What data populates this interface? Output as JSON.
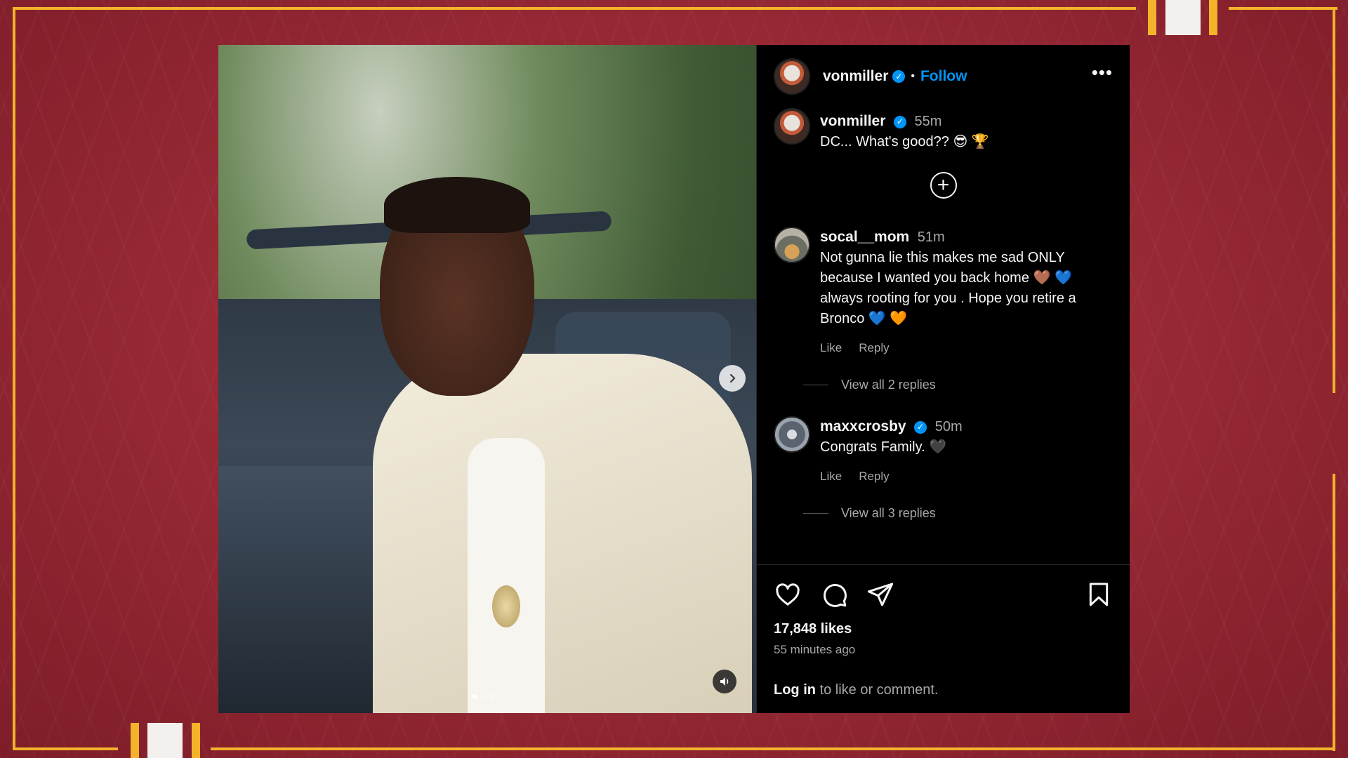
{
  "post": {
    "username": "vonmiller",
    "follow_label": "Follow",
    "separator": "•",
    "more_label": "•••",
    "caption": {
      "username": "vonmiller",
      "time": "55m",
      "text": "DC... What's good?? 😎 🏆"
    },
    "add_label": "+",
    "comments": [
      {
        "username": "socal__mom",
        "time": "51m",
        "text": "Not gunna lie this makes me sad ONLY because I wanted you back home 🤎 💙 always rooting for you . Hope you retire a Bronco 💙 🧡",
        "like_label": "Like",
        "reply_label": "Reply",
        "view_replies": "View all 2 replies"
      },
      {
        "username": "maxxcrosby",
        "time": "50m",
        "text": "Congrats Family. 🖤",
        "like_label": "Like",
        "reply_label": "Reply",
        "view_replies": "View all 3 replies"
      }
    ],
    "likes": "17,848 likes",
    "posted_ago": "55 minutes ago",
    "login_link": "Log in",
    "login_rest": " to like or comment."
  },
  "icons": {
    "verified": "verified-badge-icon",
    "next": "chevron-right-icon",
    "audio": "speaker-icon",
    "like": "heart-icon",
    "comment": "comment-bubble-icon",
    "share": "paper-plane-icon",
    "save": "bookmark-icon"
  },
  "colors": {
    "accent": "#0095f6",
    "frame": "#f3b32a",
    "background": "#9a2a36"
  },
  "media": {
    "dots_total": 3,
    "active_dot": 1
  }
}
